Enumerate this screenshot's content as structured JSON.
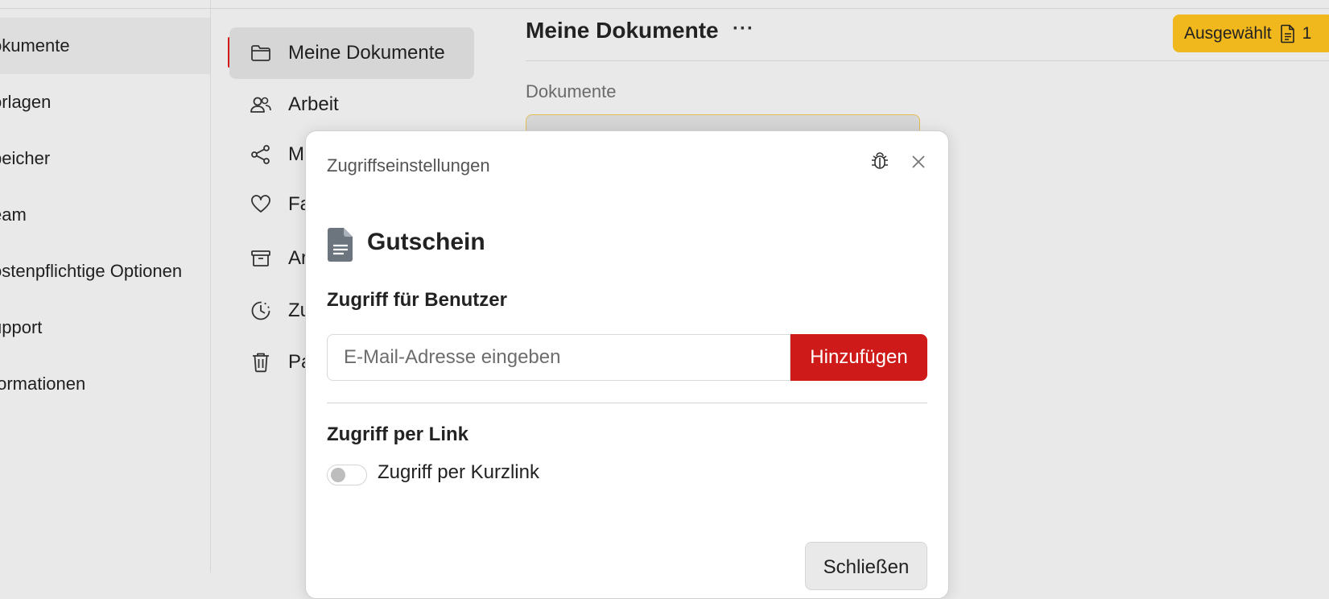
{
  "sidebar": {
    "items": [
      {
        "label": "okumente",
        "active": true
      },
      {
        "label": "orlagen"
      },
      {
        "label": "peicher"
      },
      {
        "label": "eam"
      },
      {
        "label": "ostenpflichtige Optionen"
      },
      {
        "label": "upport"
      },
      {
        "label": "formationen"
      }
    ]
  },
  "nav": {
    "items": [
      {
        "label": "Meine Dokumente",
        "icon": "folder-icon",
        "active": true
      },
      {
        "label": "Arbeit",
        "icon": "users-icon"
      },
      {
        "label": "M",
        "icon": "share-icon"
      },
      {
        "label": "Fa",
        "icon": "heart-icon"
      },
      {
        "label": "Ar",
        "icon": "archive-icon"
      },
      {
        "label": "Zu",
        "icon": "clock-icon"
      },
      {
        "label": "Pa",
        "icon": "trash-icon"
      }
    ]
  },
  "main": {
    "title": "Meine Dokumente",
    "more": "···",
    "section_label": "Dokumente",
    "selected": {
      "label": "Ausgewählt",
      "count": "1"
    }
  },
  "modal": {
    "title": "Zugriffseinstellungen",
    "doc_name": "Gutschein",
    "users_heading": "Zugriff für Benutzer",
    "email_placeholder": "E-Mail-Adresse eingeben",
    "add_label": "Hinzufügen",
    "link_heading": "Zugriff per Link",
    "toggle_label": "Zugriff per Kurzlink",
    "toggle_on": false,
    "close_label": "Schließen"
  },
  "colors": {
    "accent_red": "#cf1a1a",
    "selected_yellow": "#f0b81c",
    "doc_icon": "#6c757d"
  }
}
